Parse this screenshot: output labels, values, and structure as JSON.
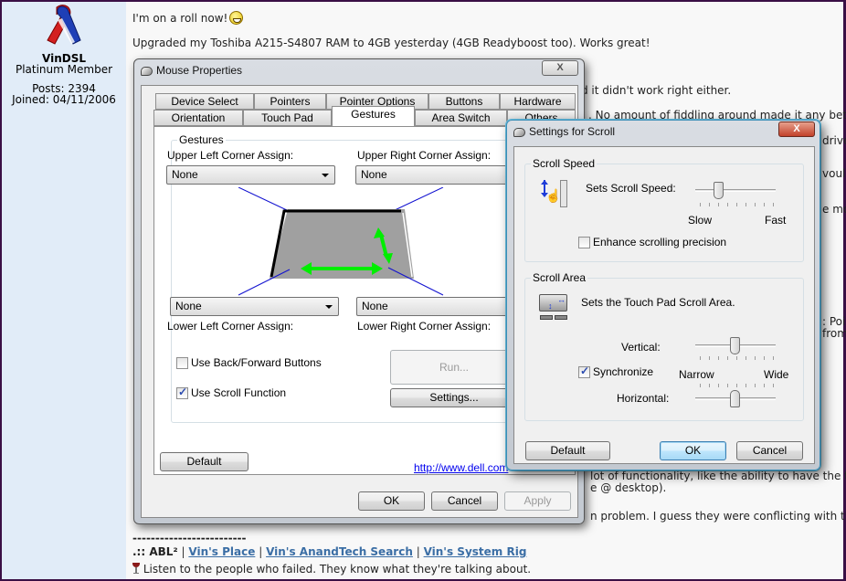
{
  "forum": {
    "user": {
      "name": "VinDSL",
      "rank": "Platinum Member",
      "posts": "Posts: 2394",
      "joined": "Joined: 04/11/2006"
    },
    "post": {
      "line1": "I'm on a roll now!",
      "line2": "Upgraded my Toshiba A215-S4807 RAM to 4GB yesterday (4GB Readyboost too). Works great!",
      "partial_lines": [
        "d it didn't work right either.",
        ". No amount of fiddling around made it any better",
        "drive",
        "vould",
        "e mo",
        ": Poir",
        "from",
        "lot of functionality, like the ability to have the tou",
        "e @ desktop).",
        "n problem. I guess they were conflicting with the"
      ]
    },
    "signature": {
      "divider": "-------------------------",
      "prefix": ".:: ABL²",
      "links": [
        "Vin's Place",
        "Vin's AnandTech Search",
        "Vin's System Rig"
      ],
      "quote": "Listen to the people who failed. They know what they're talking about."
    }
  },
  "mouse_properties": {
    "title": "Mouse Properties",
    "close_label": "X",
    "tabs_row1": [
      "Device Select",
      "Pointers",
      "Pointer Options",
      "Buttons",
      "Hardware"
    ],
    "tabs_row2": [
      "Orientation",
      "Touch Pad",
      "Gestures",
      "Area Switch",
      "Others"
    ],
    "active_tab": "Gestures",
    "gestures_group": "Gestures",
    "upper_left_label": "Upper Left Corner Assign:",
    "upper_right_label": "Upper Right Corner Assign:",
    "lower_left_label": "Lower Left Corner Assign:",
    "lower_right_label": "Lower Right Corner Assign:",
    "upper_left_value": "None",
    "upper_right_value": "None",
    "lower_left_value": "None",
    "lower_right_value": "None",
    "use_back_forward": {
      "label": "Use Back/Forward Buttons",
      "checked": false
    },
    "use_scroll": {
      "label": "Use Scroll Function",
      "checked": true
    },
    "run_button": "Run...",
    "settings_button": "Settings...",
    "default_button": "Default",
    "link": "http://www.dell.com",
    "ok_button": "OK",
    "cancel_button": "Cancel",
    "apply_button": "Apply"
  },
  "scroll_settings": {
    "title": "Settings for Scroll",
    "close_label": "X",
    "speed_group": "Scroll Speed",
    "speed_label": "Sets Scroll Speed:",
    "speed_min": "Slow",
    "speed_max": "Fast",
    "speed_value_fraction": 0.3,
    "enhance": {
      "label": "Enhance scrolling precision",
      "checked": false
    },
    "area_group": "Scroll Area",
    "area_label": "Sets the Touch Pad Scroll Area.",
    "vertical_label": "Vertical:",
    "horizontal_label": "Horizontal:",
    "area_min": "Narrow",
    "area_max": "Wide",
    "vertical_value_fraction": 0.5,
    "horizontal_value_fraction": 0.5,
    "synchronize": {
      "label": "Synchronize",
      "checked": true
    },
    "default_button": "Default",
    "ok_button": "OK",
    "cancel_button": "Cancel"
  }
}
